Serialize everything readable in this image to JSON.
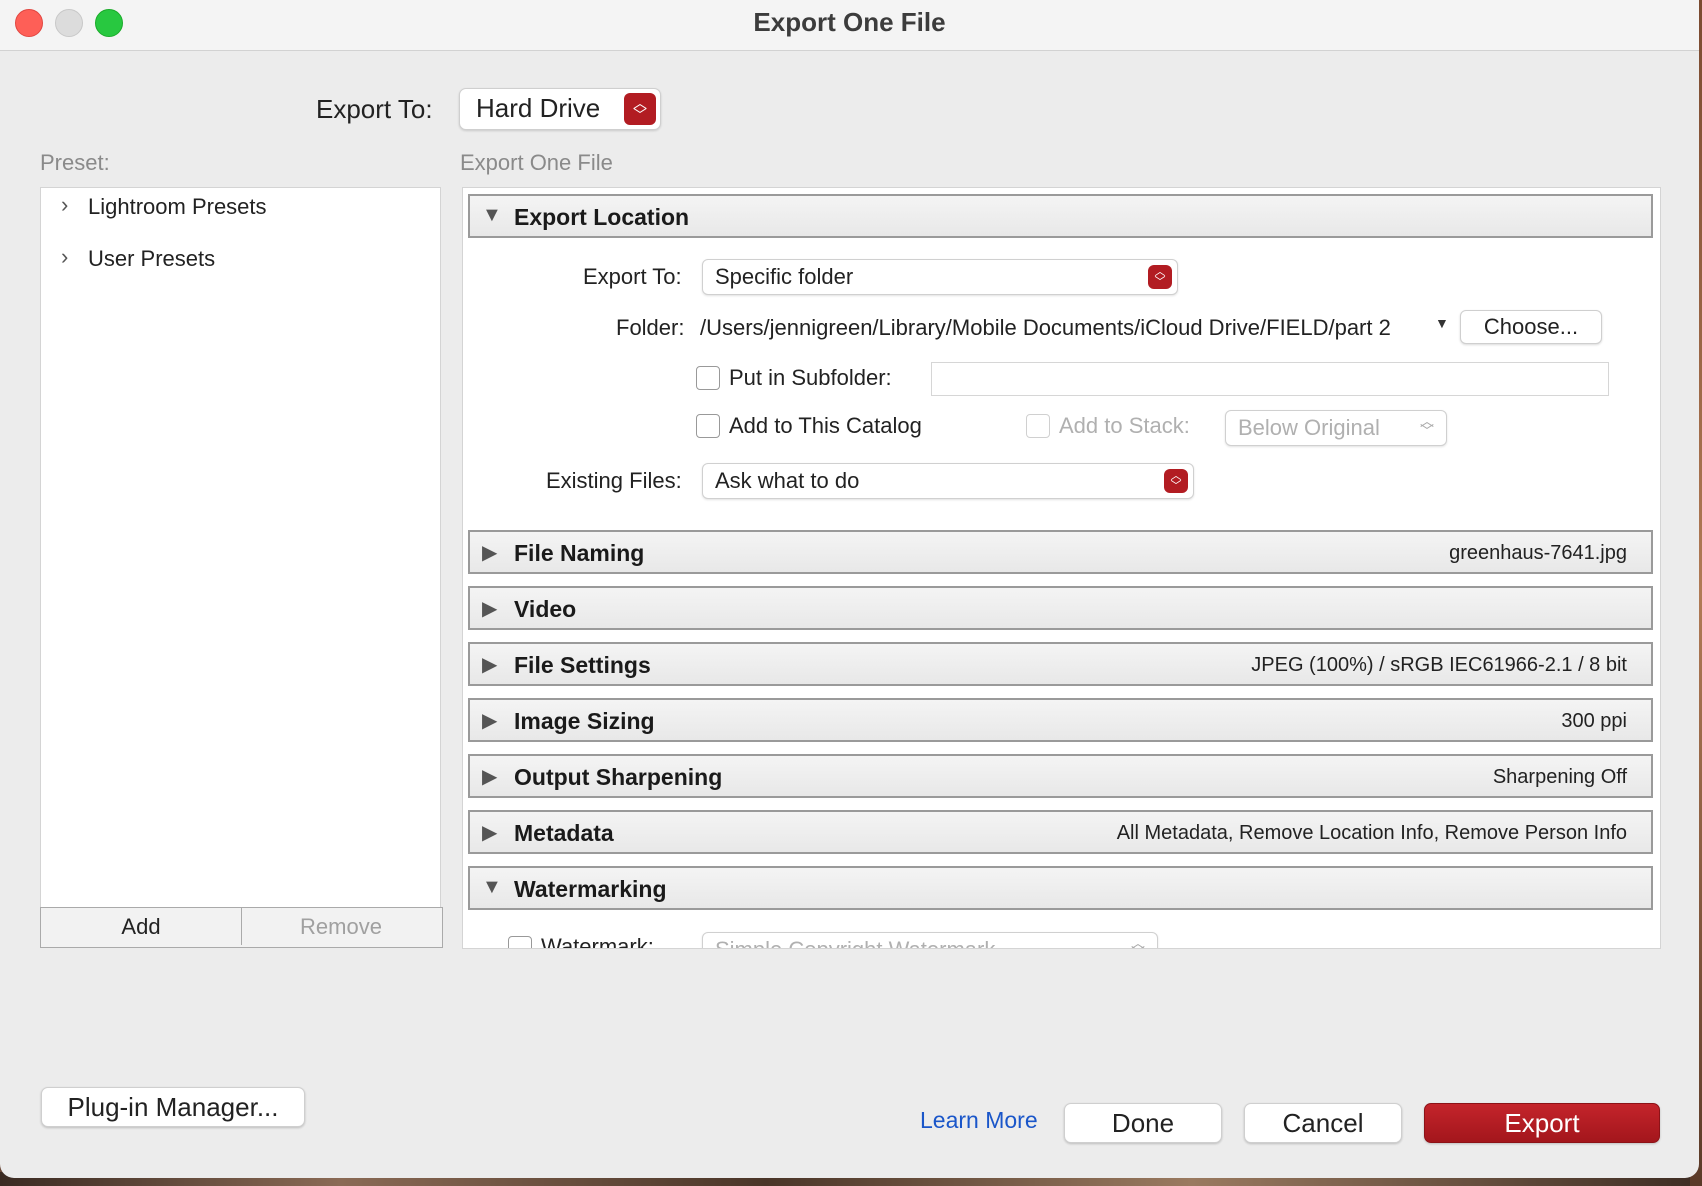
{
  "window": {
    "title": "Export One File"
  },
  "top": {
    "export_to_label": "Export To:",
    "export_to_value": "Hard Drive"
  },
  "presets": {
    "label": "Preset:",
    "items": [
      {
        "label": "Lightroom Presets"
      },
      {
        "label": "User Presets"
      }
    ],
    "add_label": "Add",
    "remove_label": "Remove"
  },
  "panel": {
    "label": "Export One File",
    "export_location": {
      "title": "Export Location",
      "export_to_label": "Export To:",
      "export_to_value": "Specific folder",
      "folder_label": "Folder:",
      "folder_path": "/Users/jennigreen/Library/Mobile Documents/iCloud Drive/FIELD/part 2",
      "choose_label": "Choose...",
      "subfolder_label": "Put in Subfolder:",
      "subfolder_value": "",
      "add_catalog_label": "Add to This Catalog",
      "add_stack_label": "Add to Stack:",
      "stack_value": "Below Original",
      "existing_files_label": "Existing Files:",
      "existing_files_value": "Ask what to do"
    },
    "sections": [
      {
        "title": "File Naming",
        "summary": "greenhaus-7641.jpg"
      },
      {
        "title": "Video",
        "summary": ""
      },
      {
        "title": "File Settings",
        "summary": "JPEG (100%) / sRGB IEC61966-2.1 / 8 bit"
      },
      {
        "title": "Image Sizing",
        "summary": "300 ppi"
      },
      {
        "title": "Output Sharpening",
        "summary": "Sharpening Off"
      },
      {
        "title": "Metadata",
        "summary": "All Metadata, Remove Location Info, Remove Person Info"
      },
      {
        "title": "Watermarking",
        "summary": ""
      }
    ],
    "watermark_label": "Watermark:",
    "watermark_value": "Simple Copyright Watermark"
  },
  "footer": {
    "plugin_manager_label": "Plug-in Manager...",
    "learn_more_label": "Learn More",
    "done_label": "Done",
    "cancel_label": "Cancel",
    "export_label": "Export"
  },
  "colors": {
    "accent": "#b21c22",
    "link": "#1a56c9"
  }
}
